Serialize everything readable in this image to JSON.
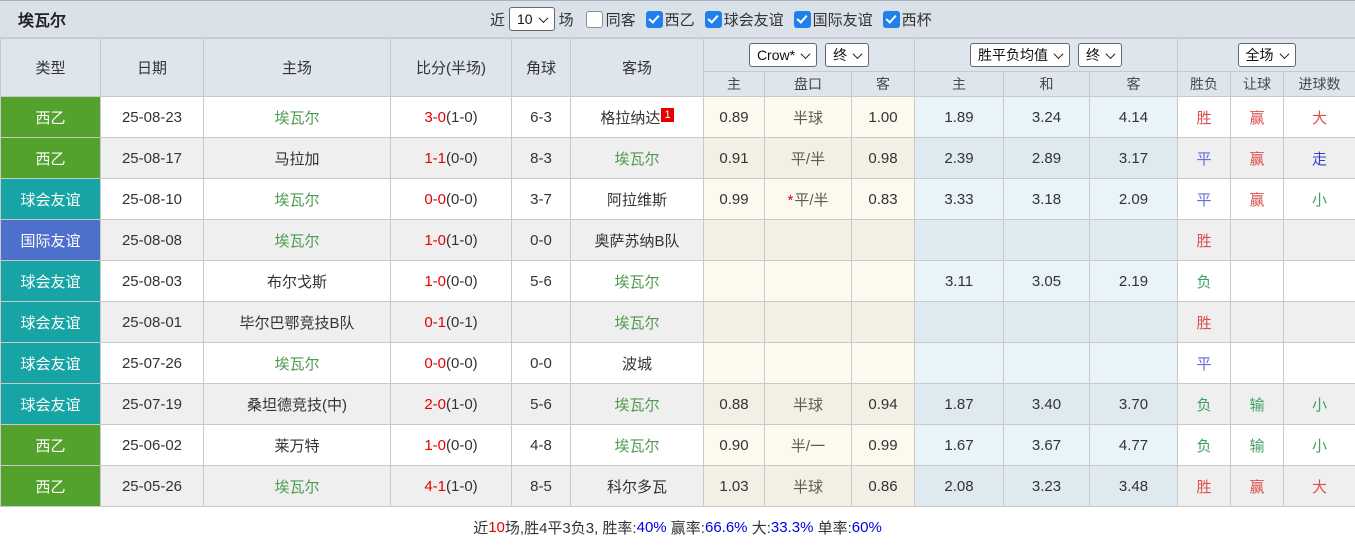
{
  "team": "埃瓦尔",
  "colors": {
    "type_green": "#54a22e",
    "type_teal": "#17a4a4",
    "type_blue": "#4d70cd",
    "score_red": "#e60000",
    "self_team_green": "#4e9b4e",
    "result_win_red": "#dd4f4f",
    "result_draw_blue": "#6a6ad8",
    "result_push_blue": "#3c3ccc",
    "result_lose_green": "#3f9e63",
    "summary_blue": "#0000e6",
    "checkbox_blue": "#1e80e8",
    "header_bg": "#dee5ec",
    "topbar_bg": "#dae1e9"
  },
  "topbar": {
    "title": "埃瓦尔",
    "recent_label": "近",
    "recent_count": "10",
    "matches_label": "场",
    "same_venue_label": "同客",
    "same_venue_checked": false,
    "league_filters": [
      {
        "label": "西乙",
        "checked": true
      },
      {
        "label": "球会友谊",
        "checked": true
      },
      {
        "label": "国际友谊",
        "checked": true
      },
      {
        "label": "西杯",
        "checked": true
      }
    ]
  },
  "header": {
    "type": "类型",
    "date": "日期",
    "home": "主场",
    "score": "比分(半场)",
    "corner": "角球",
    "away": "客场",
    "odds_source_select": "Crow*",
    "odds_time_select": "终",
    "avg_select": "胜平负均值",
    "avg_time_select": "终",
    "scope_select": "全场",
    "sub": {
      "home": "主",
      "handicap": "盘口",
      "away": "客",
      "avg_home": "主",
      "avg_draw": "和",
      "avg_away": "客",
      "result": "胜负",
      "handicap_result": "让球",
      "goals_result": "进球数"
    }
  },
  "table": {
    "rows": [
      {
        "type": "西乙",
        "date": "25-08-23",
        "home": "埃瓦尔",
        "score": "3-0",
        "half": "(1-0)",
        "corner": "6-3",
        "away": "格拉纳达",
        "away_badge": "1",
        "crow_home": "0.89",
        "handicap": "半球",
        "crow_away": "1.00",
        "avg_home": "1.89",
        "avg_draw": "3.24",
        "avg_away": "4.14",
        "result": "胜",
        "handicap_result": "赢",
        "goals_result": "大"
      },
      {
        "type": "西乙",
        "date": "25-08-17",
        "home": "马拉加",
        "score": "1-1",
        "half": "(0-0)",
        "corner": "8-3",
        "away": "埃瓦尔",
        "away_badge": "",
        "crow_home": "0.91",
        "handicap": "平/半",
        "crow_away": "0.98",
        "avg_home": "2.39",
        "avg_draw": "2.89",
        "avg_away": "3.17",
        "result": "平",
        "handicap_result": "赢",
        "goals_result": "走"
      },
      {
        "type": "球会友谊",
        "date": "25-08-10",
        "home": "埃瓦尔",
        "score": "0-0",
        "half": "(0-0)",
        "corner": "3-7",
        "away": "阿拉维斯",
        "away_badge": "",
        "crow_home": "0.99",
        "handicap": "*平/半",
        "crow_away": "0.83",
        "avg_home": "3.33",
        "avg_draw": "3.18",
        "avg_away": "2.09",
        "result": "平",
        "handicap_result": "赢",
        "goals_result": "小"
      },
      {
        "type": "国际友谊",
        "date": "25-08-08",
        "home": "埃瓦尔",
        "score": "1-0",
        "half": "(1-0)",
        "corner": "0-0",
        "away": "奥萨苏纳B队",
        "away_badge": "",
        "crow_home": "",
        "handicap": "",
        "crow_away": "",
        "avg_home": "",
        "avg_draw": "",
        "avg_away": "",
        "result": "胜",
        "handicap_result": "",
        "goals_result": ""
      },
      {
        "type": "球会友谊",
        "date": "25-08-03",
        "home": "布尔戈斯",
        "score": "1-0",
        "half": "(0-0)",
        "corner": "5-6",
        "away": "埃瓦尔",
        "away_badge": "",
        "crow_home": "",
        "handicap": "",
        "crow_away": "",
        "avg_home": "3.11",
        "avg_draw": "3.05",
        "avg_away": "2.19",
        "result": "负",
        "handicap_result": "",
        "goals_result": ""
      },
      {
        "type": "球会友谊",
        "date": "25-08-01",
        "home": "毕尔巴鄂竞技B队",
        "score": "0-1",
        "half": "(0-1)",
        "corner": "",
        "away": "埃瓦尔",
        "away_badge": "",
        "crow_home": "",
        "handicap": "",
        "crow_away": "",
        "avg_home": "",
        "avg_draw": "",
        "avg_away": "",
        "result": "胜",
        "handicap_result": "",
        "goals_result": ""
      },
      {
        "type": "球会友谊",
        "date": "25-07-26",
        "home": "埃瓦尔",
        "score": "0-0",
        "half": "(0-0)",
        "corner": "0-0",
        "away": "波城",
        "away_badge": "",
        "crow_home": "",
        "handicap": "",
        "crow_away": "",
        "avg_home": "",
        "avg_draw": "",
        "avg_away": "",
        "result": "平",
        "handicap_result": "",
        "goals_result": ""
      },
      {
        "type": "球会友谊",
        "date": "25-07-19",
        "home": "桑坦德竞技(中)",
        "score": "2-0",
        "half": "(1-0)",
        "corner": "5-6",
        "away": "埃瓦尔",
        "away_badge": "",
        "crow_home": "0.88",
        "handicap": "半球",
        "crow_away": "0.94",
        "avg_home": "1.87",
        "avg_draw": "3.40",
        "avg_away": "3.70",
        "result": "负",
        "handicap_result": "输",
        "goals_result": "小"
      },
      {
        "type": "西乙",
        "date": "25-06-02",
        "home": "莱万特",
        "score": "1-0",
        "half": "(0-0)",
        "corner": "4-8",
        "away": "埃瓦尔",
        "away_badge": "",
        "crow_home": "0.90",
        "handicap": "半/一",
        "crow_away": "0.99",
        "avg_home": "1.67",
        "avg_draw": "3.67",
        "avg_away": "4.77",
        "result": "负",
        "handicap_result": "输",
        "goals_result": "小"
      },
      {
        "type": "西乙",
        "date": "25-05-26",
        "home": "埃瓦尔",
        "score": "4-1",
        "half": "(1-0)",
        "corner": "8-5",
        "away": "科尔多瓦",
        "away_badge": "",
        "crow_home": "1.03",
        "handicap": "半球",
        "crow_away": "0.86",
        "avg_home": "2.08",
        "avg_draw": "3.23",
        "avg_away": "3.48",
        "result": "胜",
        "handicap_result": "赢",
        "goals_result": "大"
      }
    ]
  },
  "summary": {
    "segments": [
      {
        "text": "近",
        "color": "dark"
      },
      {
        "text": "10",
        "color": "red"
      },
      {
        "text": "场,胜4平3负3, 胜率:",
        "color": "dark"
      },
      {
        "text": "40%",
        "color": "blue"
      },
      {
        "text": " 赢率:",
        "color": "dark"
      },
      {
        "text": "66.6%",
        "color": "blue"
      },
      {
        "text": " 大:",
        "color": "dark"
      },
      {
        "text": "33.3%",
        "color": "blue"
      },
      {
        "text": " 单率:",
        "color": "dark"
      },
      {
        "text": "60%",
        "color": "blue"
      }
    ]
  }
}
